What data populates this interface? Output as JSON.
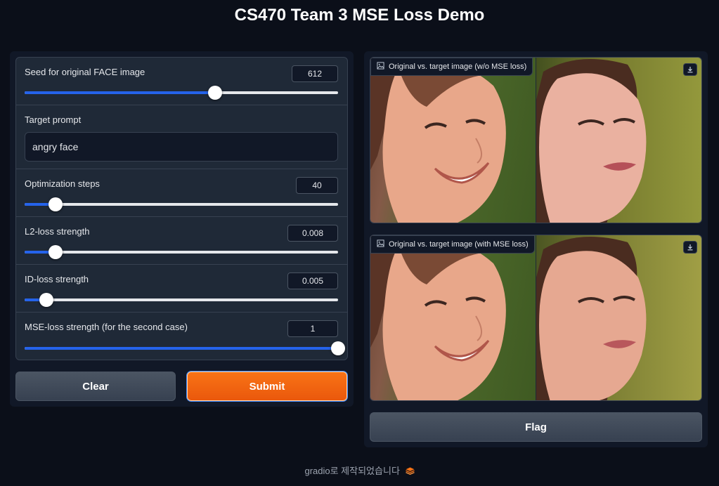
{
  "app_title": "CS470 Team 3 MSE Loss Demo",
  "inputs": {
    "seed": {
      "label": "Seed for original FACE image",
      "value": "612",
      "fraction": 0.607
    },
    "prompt": {
      "label": "Target prompt",
      "value": "angry face"
    },
    "steps": {
      "label": "Optimization steps",
      "value": "40",
      "fraction": 0.098
    },
    "l2": {
      "label": "L2-loss strength",
      "value": "0.008",
      "fraction": 0.098
    },
    "id": {
      "label": "ID-loss strength",
      "value": "0.005",
      "fraction": 0.07
    },
    "mse": {
      "label": "MSE-loss strength (for the second case)",
      "value": "1",
      "fraction": 1.0
    }
  },
  "buttons": {
    "clear": "Clear",
    "submit": "Submit",
    "flag": "Flag"
  },
  "outputs": {
    "without_mse": {
      "label": "Original vs. target image (w/o MSE loss)"
    },
    "with_mse": {
      "label": "Original vs. target image (with MSE loss)"
    }
  },
  "footer": {
    "text": "gradio로 제작되었습니다"
  },
  "colors": {
    "accent": "#2563eb",
    "submit": "#f97316",
    "background": "#0b0f19"
  }
}
